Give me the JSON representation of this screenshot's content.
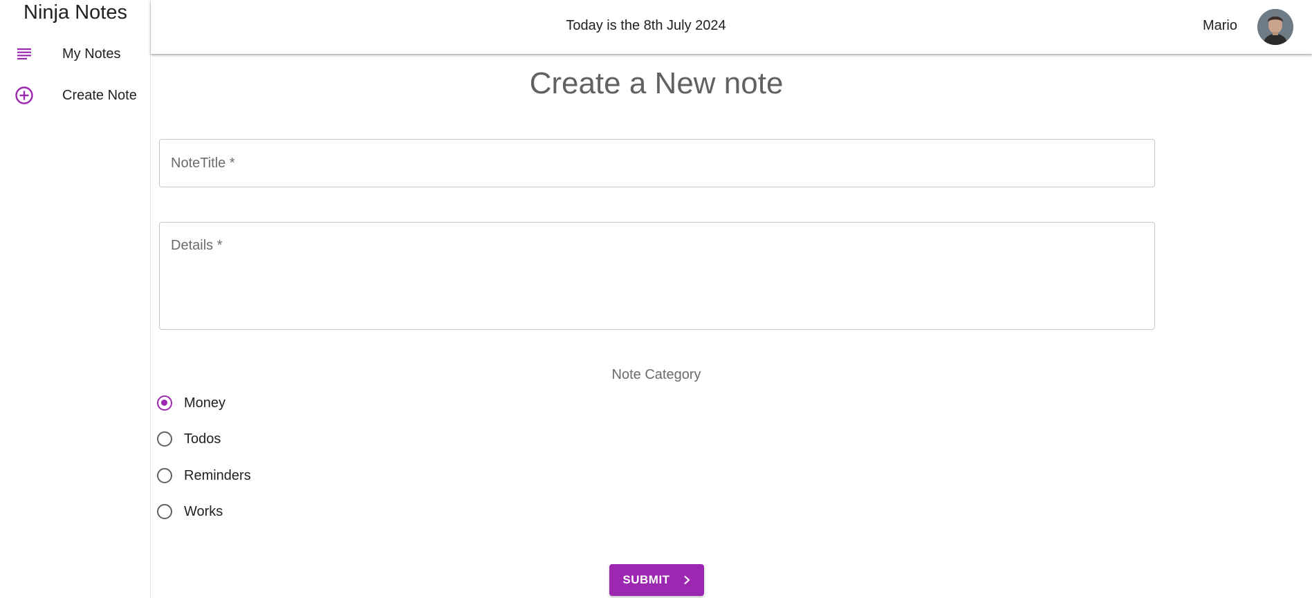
{
  "sidebar": {
    "brand": "Ninja Notes",
    "items": [
      {
        "label": "My Notes",
        "icon": "subject-icon"
      },
      {
        "label": "Create Note",
        "icon": "add-circle-icon"
      }
    ]
  },
  "header": {
    "date_text": "Today is the 8th July 2024",
    "user_name": "Mario"
  },
  "main": {
    "title": "Create a New note",
    "note_title_placeholder": "NoteTitle *",
    "details_placeholder": "Details *",
    "category_label": "Note Category",
    "categories": [
      {
        "label": "Money",
        "checked": true
      },
      {
        "label": "Todos",
        "checked": false
      },
      {
        "label": "Reminders",
        "checked": false
      },
      {
        "label": "Works",
        "checked": false
      }
    ],
    "selected_category": "Money",
    "submit_label": "SUBMIT"
  },
  "colors": {
    "accent": "#9c27b0",
    "title_gray": "#616161"
  }
}
